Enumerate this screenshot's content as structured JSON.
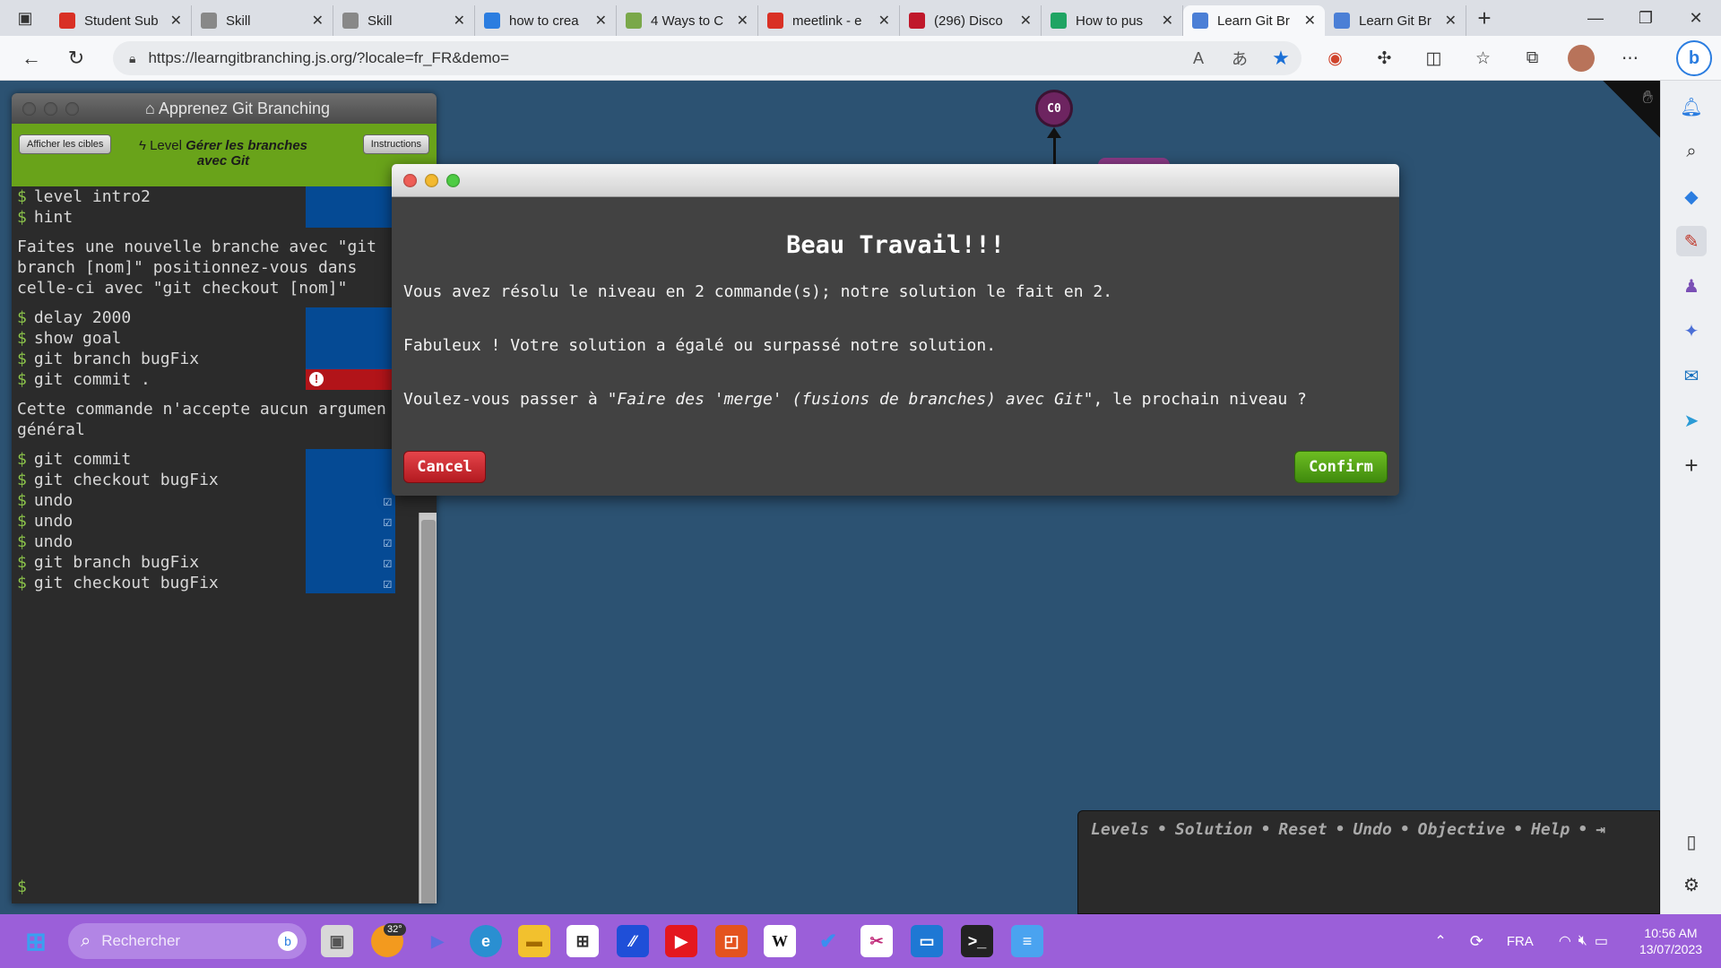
{
  "browser": {
    "tabs": [
      {
        "title": "Student Sub",
        "icon": "gmail-icon",
        "color": "#d93025"
      },
      {
        "title": "Skill",
        "icon": "page-icon",
        "color": "#888888"
      },
      {
        "title": "Skill",
        "icon": "page-icon",
        "color": "#888888"
      },
      {
        "title": "how to crea",
        "icon": "search-icon",
        "color": "#2b7de0"
      },
      {
        "title": "4 Ways to C",
        "icon": "wikihow-icon",
        "color": "#7aa84a"
      },
      {
        "title": "meetlink - e",
        "icon": "gmail-icon",
        "color": "#d93025"
      },
      {
        "title": "(296) Disco",
        "icon": "discord-icon",
        "color": "#c0182b"
      },
      {
        "title": "How to pus",
        "icon": "drive-icon",
        "color": "#1fa463"
      },
      {
        "title": "Learn Git Br",
        "icon": "git-icon",
        "color": "#4b7fd6"
      },
      {
        "title": "Learn Git Br",
        "icon": "git-icon",
        "color": "#4b7fd6"
      }
    ],
    "url": "https://learngitbranching.js.org/?locale=fr_FR&demo="
  },
  "panel": {
    "title": "Apprenez Git Branching",
    "show_targets": "Afficher les cibles",
    "level_prefix": "Level",
    "level_name": "Gérer les branches avec Git",
    "instructions": "Instructions"
  },
  "terminal": {
    "block1": [
      {
        "cmd": "level intro2",
        "status": "ok"
      },
      {
        "cmd": "hint",
        "status": "ok"
      }
    ],
    "hint_msg": "Faites une nouvelle branche avec \"git\nbranch [nom]\" positionnez-vous dans\ncelle-ci avec \"git checkout [nom]\"",
    "block2": [
      {
        "cmd": "delay 2000",
        "status": "ok"
      },
      {
        "cmd": "show goal",
        "status": "ok"
      },
      {
        "cmd": "git branch bugFix",
        "status": "ok"
      },
      {
        "cmd": "git commit .",
        "status": "error"
      }
    ],
    "error_msg": "Cette commande n'accepte aucun argumen\ngénéral",
    "block3": [
      {
        "cmd": "git commit",
        "status": "ok"
      },
      {
        "cmd": "git checkout bugFix",
        "status": "ok"
      },
      {
        "cmd": "undo",
        "status": "check"
      },
      {
        "cmd": "undo",
        "status": "check"
      },
      {
        "cmd": "undo",
        "status": "check"
      },
      {
        "cmd": "git branch bugFix",
        "status": "check"
      },
      {
        "cmd": "git checkout bugFix",
        "status": "check"
      }
    ],
    "prompt": "$"
  },
  "visual": {
    "commit_label": "C0"
  },
  "modal": {
    "title": "Beau Travail!!!",
    "line1": "Vous avez résolu le niveau en 2 commande(s); notre solution le fait en 2.",
    "line2": "Fabuleux ! Votre solution a égalé ou surpassé notre solution.",
    "line3_pre": "Voulez-vous passer à ",
    "line3_em": "\"Faire des 'merge' (fusions de branches) avec Git\"",
    "line3_post": ", le prochain niveau ?",
    "cancel": "Cancel",
    "confirm": "Confirm"
  },
  "commandbar": {
    "links": [
      "Levels",
      "Solution",
      "Reset",
      "Undo",
      "Objective",
      "Help"
    ]
  },
  "taskbar": {
    "search_placeholder": "Rechercher",
    "weather_temp": "32°",
    "lang": "FRA",
    "time": "10:56 AM",
    "date": "13/07/2023"
  }
}
